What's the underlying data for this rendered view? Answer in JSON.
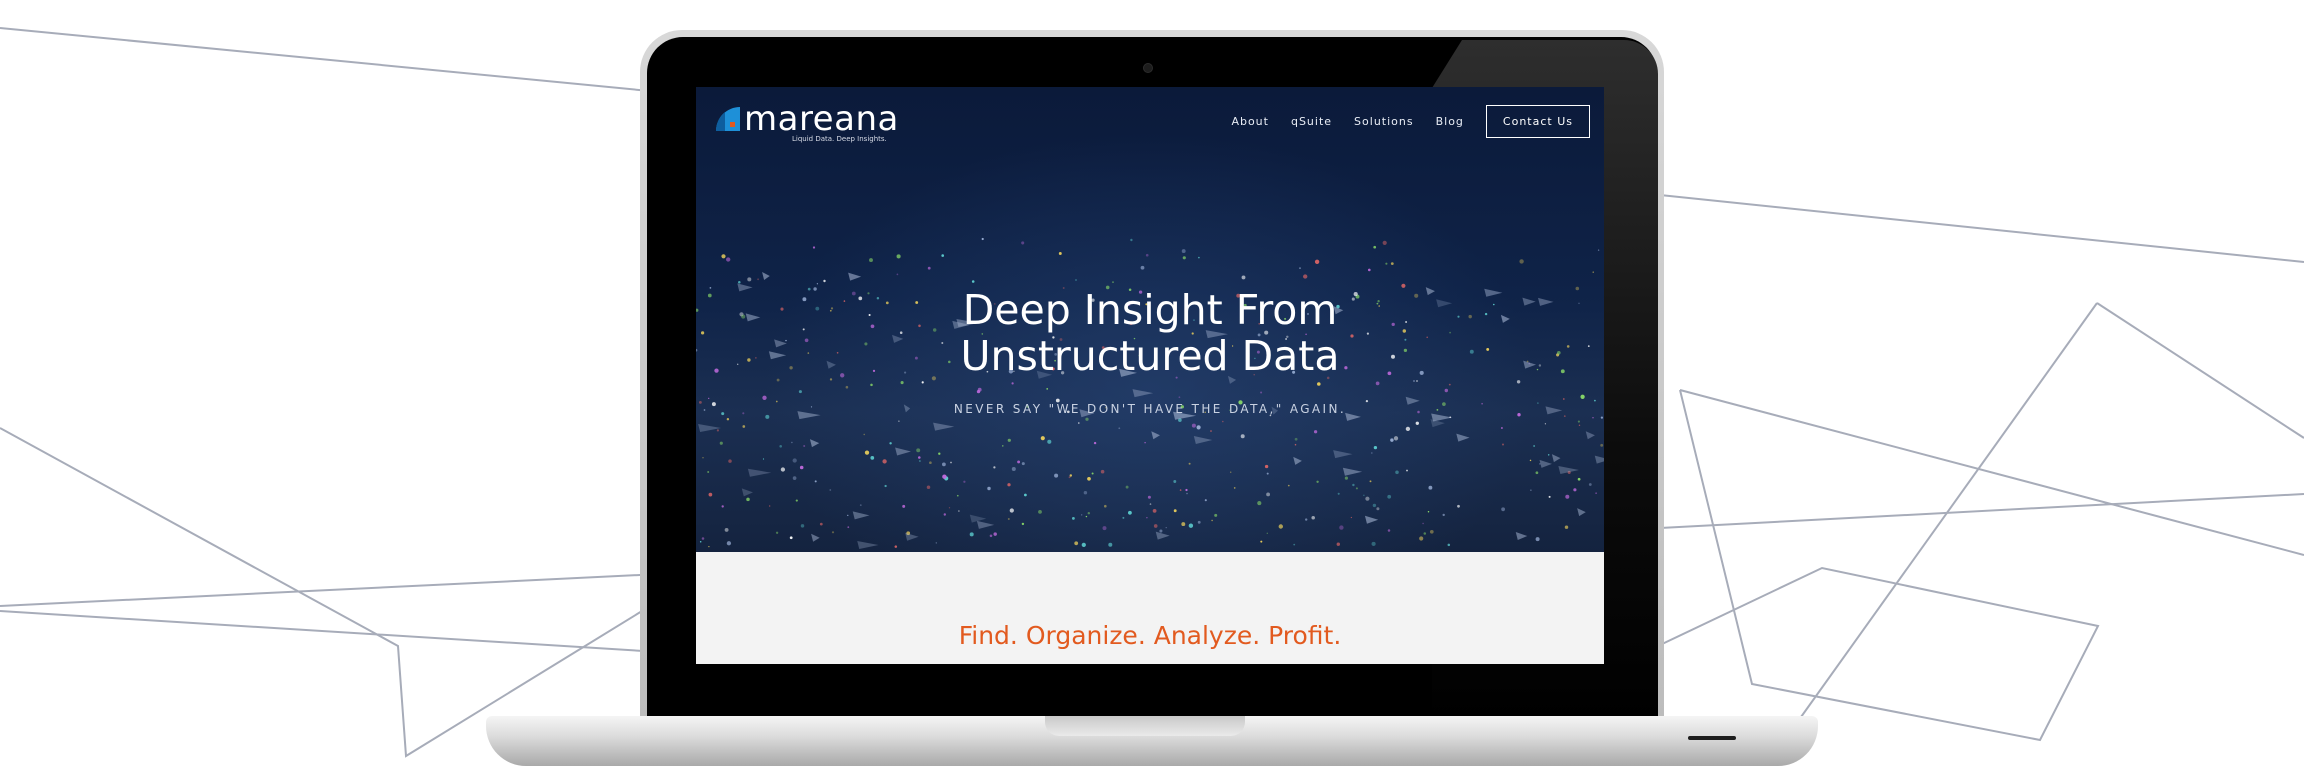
{
  "brand": {
    "name": "mareana",
    "tagline": "Liquid Data. Deep Insights.",
    "colors": {
      "accent_orange": "#e25a1f",
      "logo_blue": "#1e90d8",
      "hero_navy": "#0b1a3a"
    }
  },
  "nav": {
    "items": [
      {
        "label": "About"
      },
      {
        "label": "qSuite"
      },
      {
        "label": "Solutions"
      },
      {
        "label": "Blog"
      }
    ],
    "cta": "Contact Us"
  },
  "hero": {
    "title_line1": "Deep Insight From",
    "title_line2": "Unstructured Data",
    "subtitle": "NEVER SAY \"WE DON'T HAVE THE DATA,\" AGAIN."
  },
  "section": {
    "tagline": "Find. Organize. Analyze. Profit."
  },
  "icons": [
    "mareana-logo-icon",
    "webcam-icon"
  ]
}
